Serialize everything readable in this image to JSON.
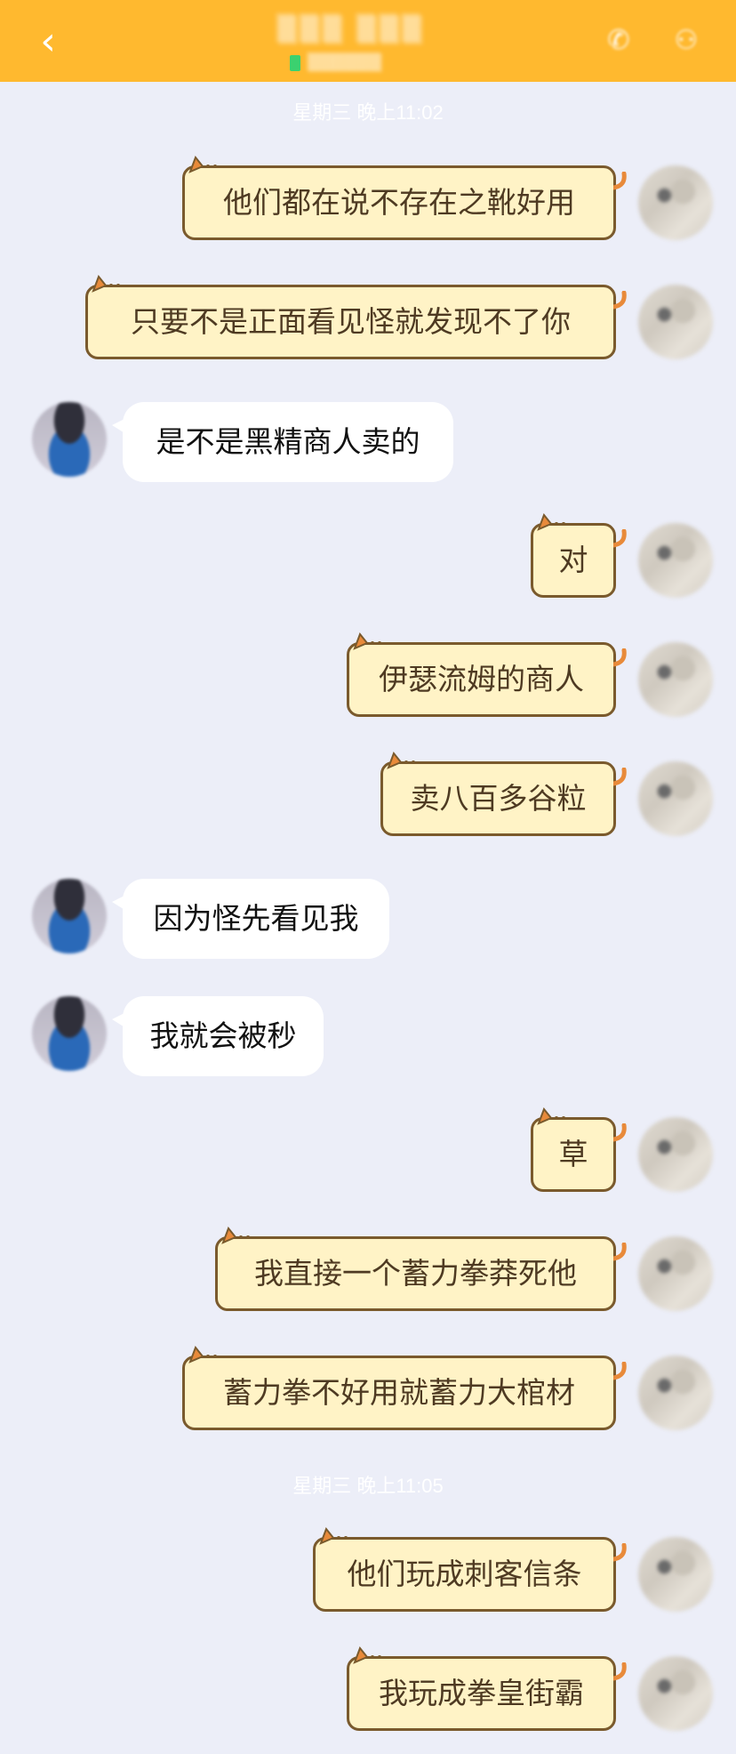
{
  "header": {
    "back_icon": "chevron-left-icon",
    "title": "▒▒▒ ▒▒▒",
    "status": "▒▒▒▒▒▒",
    "icons": [
      "phone-icon",
      "person-icon"
    ],
    "bg_color": "#ffb92f"
  },
  "timestamps": [
    "星期三 晚上11:02",
    "星期三 晚上11:05"
  ],
  "messages": [
    {
      "from": "me",
      "text": "他们都在说不存在之靴好用"
    },
    {
      "from": "me",
      "text": "只要不是正面看见怪就发现不了你"
    },
    {
      "from": "other",
      "text": "是不是黑精商人卖的"
    },
    {
      "from": "me",
      "text": "对"
    },
    {
      "from": "me",
      "text": "伊瑟流姆的商人"
    },
    {
      "from": "me",
      "text": "卖八百多谷粒"
    },
    {
      "from": "other",
      "text": "因为怪先看见我"
    },
    {
      "from": "other",
      "text": "我就会被秒"
    },
    {
      "from": "me",
      "text": "草"
    },
    {
      "from": "me",
      "text": "我直接一个蓄力拳莽死他"
    },
    {
      "from": "me",
      "text": "蓄力拳不好用就蓄力大棺材"
    },
    {
      "from": "me",
      "text": "他们玩成刺客信条"
    },
    {
      "from": "me",
      "text": "我玩成拳皇街霸"
    }
  ],
  "colors": {
    "background": "#eceef8",
    "bubble_me_fill": "#fff3c6",
    "bubble_me_border": "#7a5a2d",
    "bubble_other_fill": "#ffffff"
  }
}
